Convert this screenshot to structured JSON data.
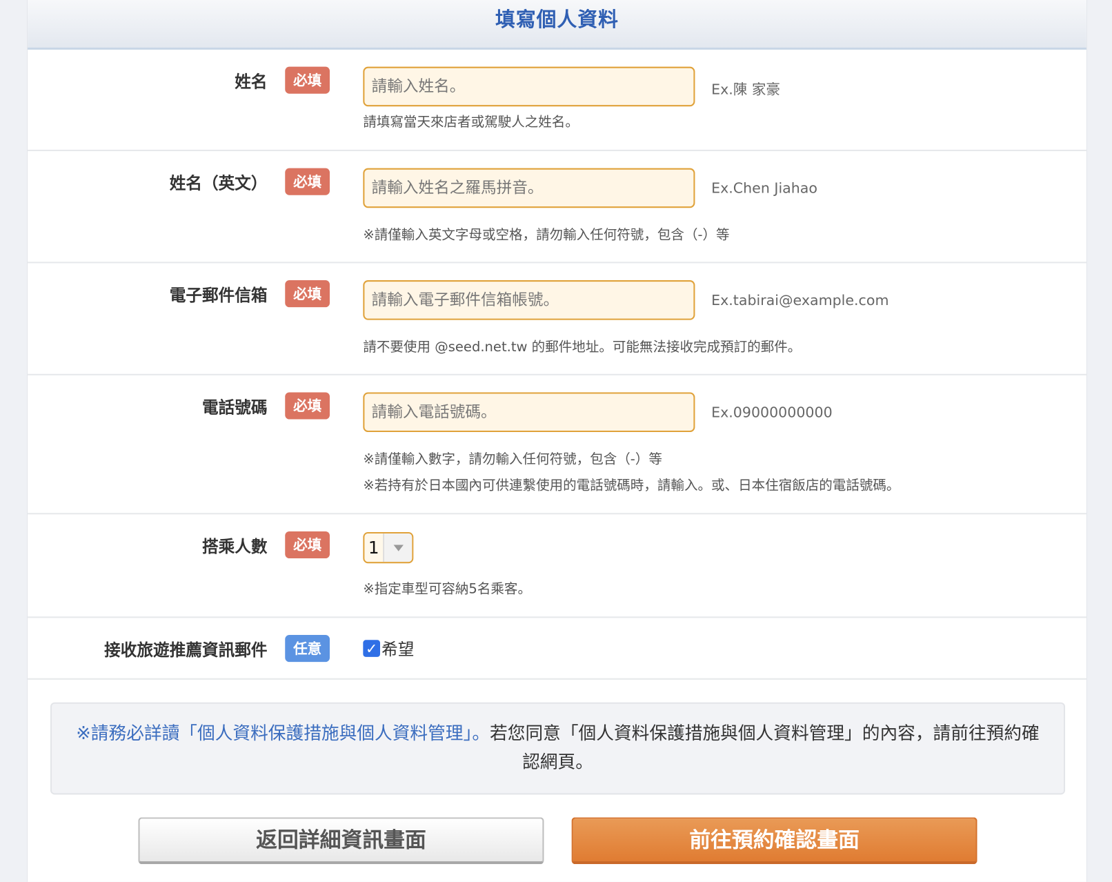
{
  "header": {
    "title": "填寫個人資料"
  },
  "fields": [
    {
      "label": "姓名",
      "badge": "必填",
      "placeholder": "請輸入姓名。",
      "example": "Ex.陳 家豪",
      "notes": [
        "請填寫當天來店者或駕駛人之姓名。"
      ]
    },
    {
      "label": "姓名（英文）",
      "badge": "必填",
      "placeholder": "請輸入姓名之羅馬拼音。",
      "example": "Ex.Chen Jiahao",
      "notes": [
        "※請僅輸入英文字母或空格，請勿輸入任何符號，包含（-）等"
      ]
    },
    {
      "label": "電子郵件信箱",
      "badge": "必填",
      "placeholder": "請輸入電子郵件信箱帳號。",
      "example": "Ex.tabirai@example.com",
      "notes": [
        "請不要使用 @seed.net.tw 的郵件地址。可能無法接收完成預訂的郵件。"
      ]
    },
    {
      "label": "電話號碼",
      "badge": "必填",
      "placeholder": "請輸入電話號碼。",
      "example": "Ex.09000000000",
      "notes": [
        "※請僅輸入數字，請勿輸入任何符號，包含（-）等",
        "※若持有於日本國內可供連繫使用的電話號碼時，請輸入。或、日本住宿飯店的電話號碼。"
      ]
    }
  ],
  "passengers": {
    "label": "搭乘人數",
    "badge": "必填",
    "selected": "1",
    "note": "※指定車型可容納5名乘客。"
  },
  "newsletter": {
    "label": "接收旅遊推薦資訊郵件",
    "badge": "任意",
    "checked": true,
    "option": "希望"
  },
  "notice": {
    "link_text": "※請務必詳讀「個人資料保護措施與個人資料管理」。",
    "text": "若您同意「個人資料保護措施與個人資料管理」的內容，請前往預約確認網頁。"
  },
  "buttons": {
    "back": "返回詳細資訊畫面",
    "next": "前往預約確認畫面"
  },
  "colors": {
    "required": "#db7461",
    "optional": "#5b93e2",
    "accent": "#e07c32",
    "title": "#2f5fb3"
  }
}
